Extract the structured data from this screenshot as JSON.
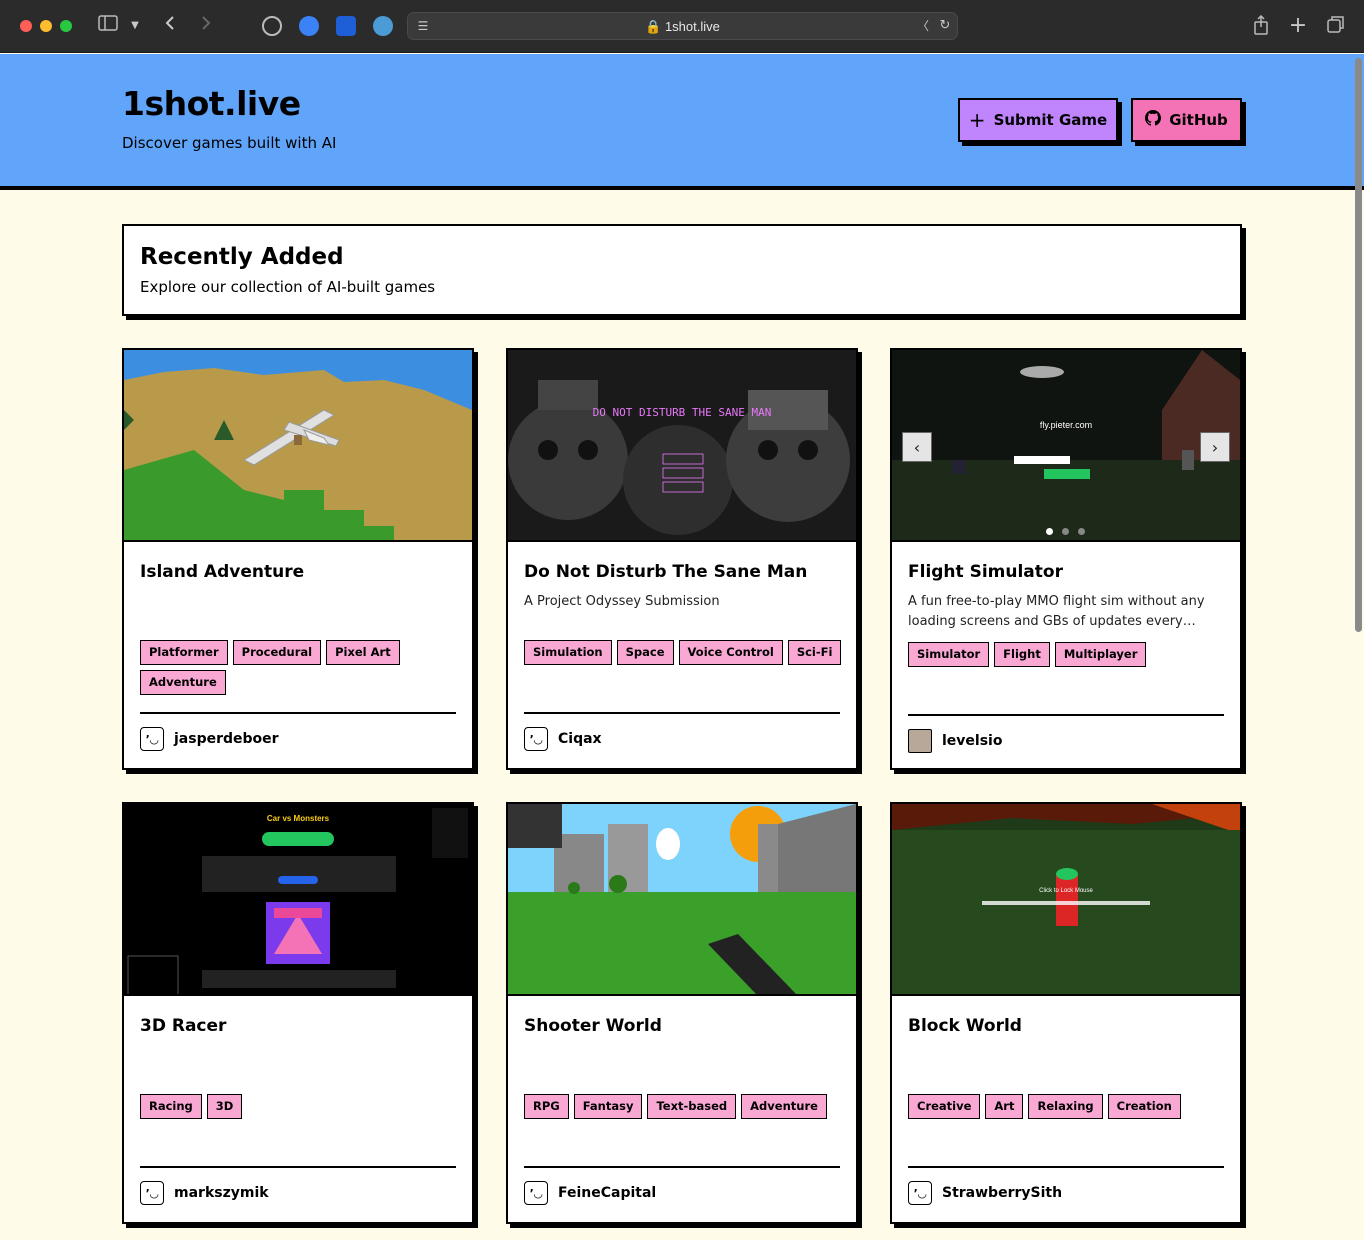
{
  "browser": {
    "url": "1shot.live"
  },
  "header": {
    "title": "1shot.live",
    "subtitle": "Discover games built with AI",
    "submit_label": "Submit Game",
    "github_label": "GitHub"
  },
  "section": {
    "title": "Recently Added",
    "subtitle": "Explore our collection of AI-built games"
  },
  "games": [
    {
      "title": "Island Adventure",
      "description": "",
      "tags": [
        "Platformer",
        "Procedural",
        "Pixel Art",
        "Adventure"
      ],
      "author": "jasperdeboer"
    },
    {
      "title": "Do Not Disturb The Sane Man",
      "description": "A Project Odyssey Submission",
      "tags": [
        "Simulation",
        "Space",
        "Voice Control",
        "Sci-Fi"
      ],
      "author": "Ciqax",
      "thumb_text": "DO NOT DISTURB THE SANE MAN"
    },
    {
      "title": "Flight Simulator",
      "description": "A fun free-to-play MMO flight sim without any loading screens and GBs of updates every…",
      "tags": [
        "Simulator",
        "Flight",
        "Multiplayer"
      ],
      "author": "levelsio",
      "thumb_text": "fly.pieter.com"
    },
    {
      "title": "3D Racer",
      "description": "",
      "tags": [
        "Racing",
        "3D"
      ],
      "author": "markszymik",
      "thumb_text": "Car vs Monsters"
    },
    {
      "title": "Shooter World",
      "description": "",
      "tags": [
        "RPG",
        "Fantasy",
        "Text-based",
        "Adventure"
      ],
      "author": "FeineCapital"
    },
    {
      "title": "Block World",
      "description": "",
      "tags": [
        "Creative",
        "Art",
        "Relaxing",
        "Creation"
      ],
      "author": "StrawberrySith",
      "thumb_text": "Click to Lock Mouse"
    }
  ],
  "colors": {
    "header_bg": "#60a5fa",
    "page_bg": "#fefce8",
    "submit_bg": "#c084fc",
    "github_bg": "#f472b6",
    "tag_bg": "#f9a8d4"
  }
}
